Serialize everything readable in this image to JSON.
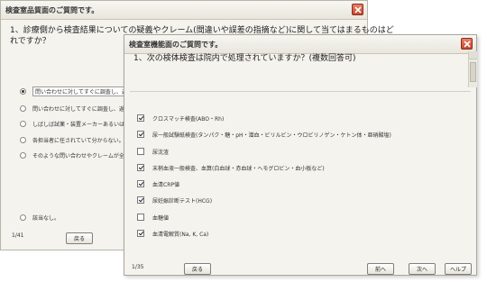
{
  "back_window": {
    "title": "検査室品質面のご質問です。",
    "question_line1": "1、診療側から検査結果についての疑義やクレーム(間違いや誤差の指摘など)に関して当てはまるものはど",
    "question_line2": "れですか？",
    "options": [
      {
        "label": "問い合わせに対してすぐに調査し、返答",
        "selected": true
      },
      {
        "label": "問い合わせに対してすぐに調査し、返答",
        "selected": false
      },
      {
        "label": "しばしば試薬・装置メーカーあるいは外注",
        "selected": false
      },
      {
        "label": "各担当者に任されていて分からない。",
        "selected": false
      },
      {
        "label": "そのような問い合わせやクレームが全くな",
        "selected": false
      }
    ],
    "extra_option": "該当なし。",
    "page": "1/41",
    "back_label": "戻る"
  },
  "front_window": {
    "title": "検査室機能面のご質問です。",
    "question": "1、次の検体検査は院内で処理されていますか？(複数回答可)",
    "items": [
      {
        "label": "クロスマッチ検査(ABO・Rh)",
        "checked": true
      },
      {
        "label": "尿一般試験紙検査(タンパク・糖・pH・潜血・ビリルビン・ウロビリノゲン・ケトン体・亜硝酸塩)",
        "checked": true
      },
      {
        "label": "尿沈渣",
        "checked": false
      },
      {
        "label": "末梢血液一般検査、血算(白血球・赤血球・ヘモグロビン・血小板など)",
        "checked": true
      },
      {
        "label": "血清CRP値",
        "checked": true
      },
      {
        "label": "尿妊娠診断テスト(HCG)",
        "checked": true
      },
      {
        "label": "血糖値",
        "checked": false
      },
      {
        "label": "血清電解質(Na, K, Ca)",
        "checked": true
      }
    ],
    "page": "1/35",
    "back_label": "戻る",
    "prev_label": "前へ",
    "next_label": "次へ",
    "help_label": "ヘルプ"
  }
}
